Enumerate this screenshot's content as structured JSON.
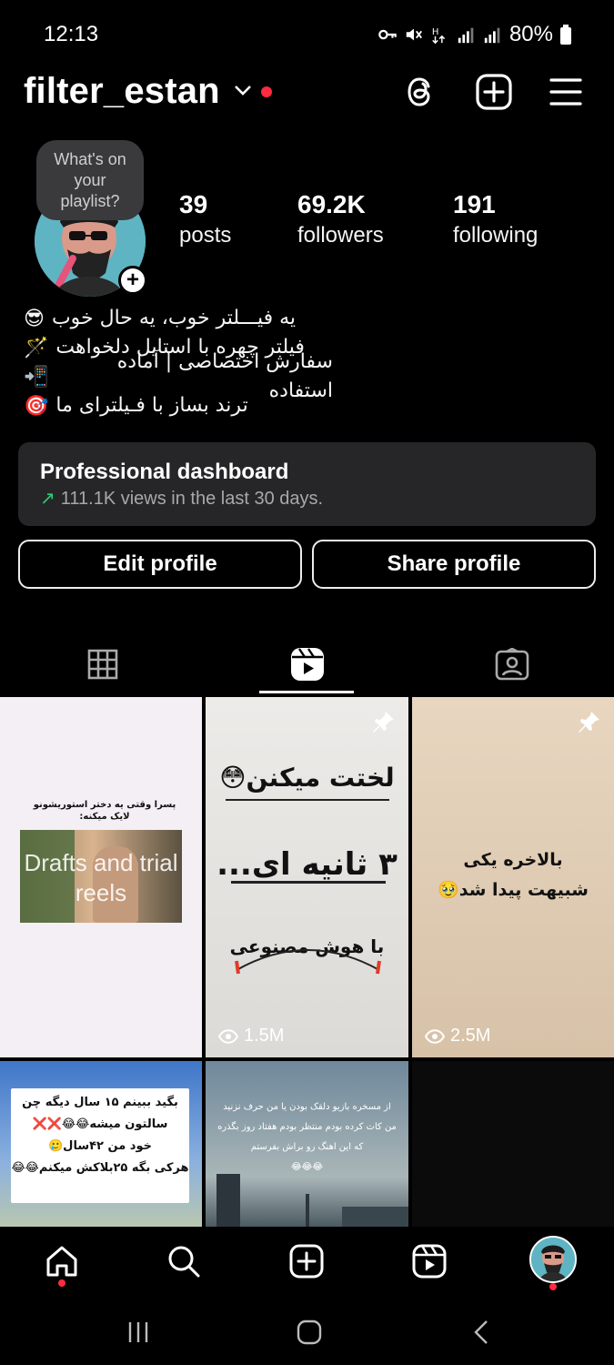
{
  "status_bar": {
    "time": "12:13",
    "battery": "80%",
    "icons": [
      "key-icon",
      "mute-icon",
      "data-icon",
      "signal-icon",
      "signal-icon",
      "battery-icon"
    ]
  },
  "header": {
    "username": "filter_estan",
    "icons": [
      "threads-icon",
      "create-icon",
      "menu-icon"
    ]
  },
  "note": {
    "text": "What's on your playlist?"
  },
  "stats": [
    {
      "value": "39",
      "label": "posts"
    },
    {
      "value": "69.2K",
      "label": "followers"
    },
    {
      "value": "191",
      "label": "following"
    }
  ],
  "bio": [
    {
      "text": "یه فیـــلتر خوب، یه حال خوب",
      "emoji": "😎"
    },
    {
      "text": "فیلتر چهره با استایل دلخواهت",
      "emoji": "🪄"
    },
    {
      "text": "سفارش اختصاصی | آماده استفاده",
      "emoji": "📲"
    },
    {
      "text": "ترند بساز با فـیلترای ما",
      "emoji": "🎯"
    }
  ],
  "dashboard": {
    "title": "Professional dashboard",
    "subtitle": "111.1K views in the last 30 days."
  },
  "buttons": {
    "edit": "Edit profile",
    "share": "Share profile"
  },
  "tabs": [
    "grid-icon",
    "reels-icon",
    "tagged-icon"
  ],
  "grid": {
    "cell1": {
      "caption": "پسرا وقتی یه دختر استوریشونو لایک میکنه:",
      "overlay": "Drafts and trial reels"
    },
    "cell2": {
      "line1": "لختت میکنن😳",
      "line2": "۳ ثانیه ای...",
      "line3": "با هوش مصنوعی",
      "views": "1.5M"
    },
    "cell3": {
      "line1": "بالاخره یکی",
      "line2": "شبیهت پیدا شد🥹",
      "views": "2.5M"
    },
    "cell4": {
      "line1": "بگید ببینم ۱۵ سال دیگه چن",
      "line2": "سالتون میشه😂😂❌❌",
      "line3": "خود من ۴۲سال🥲",
      "line4": "هرکی بگه ۲۵بلاکش میکنم😂😂"
    },
    "cell5": {
      "line1": "از مسخره بازیو دلقک بودن یا من حرف نزنید",
      "line2": "من کات کرده بودم منتظر بودم هفتاد روز بگذره",
      "line3": "که این اهنگ رو براش بفرستم",
      "line4": "😂😂😂"
    }
  },
  "nav": [
    "home-icon",
    "search-icon",
    "create-icon",
    "reels-icon",
    "profile-avatar"
  ],
  "system_nav": [
    "recents-icon",
    "home-button-icon",
    "back-icon"
  ]
}
